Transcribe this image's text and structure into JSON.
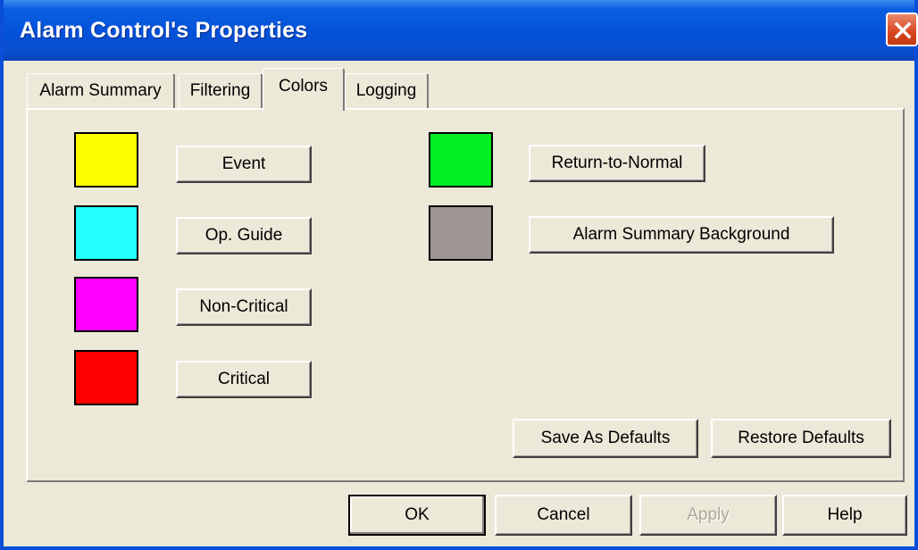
{
  "window": {
    "title": "Alarm Control's Properties"
  },
  "tabs": [
    {
      "label": "Alarm Summary",
      "active": false
    },
    {
      "label": "Filtering",
      "active": false
    },
    {
      "label": "Colors",
      "active": true
    },
    {
      "label": "Logging",
      "active": false
    }
  ],
  "colors": {
    "items": [
      {
        "label": "Event",
        "color": "#ffff00"
      },
      {
        "label": "Op. Guide",
        "color": "#22ffff"
      },
      {
        "label": "Non-Critical",
        "color": "#ff00ff"
      },
      {
        "label": "Critical",
        "color": "#ff0000"
      },
      {
        "label": "Return-to-Normal",
        "color": "#00ee22"
      },
      {
        "label": "Alarm Summary Background",
        "color": "#a09494"
      }
    ],
    "save_defaults": "Save As Defaults",
    "restore_defaults": "Restore Defaults"
  },
  "footer": {
    "ok": "OK",
    "cancel": "Cancel",
    "apply": "Apply",
    "help": "Help"
  }
}
